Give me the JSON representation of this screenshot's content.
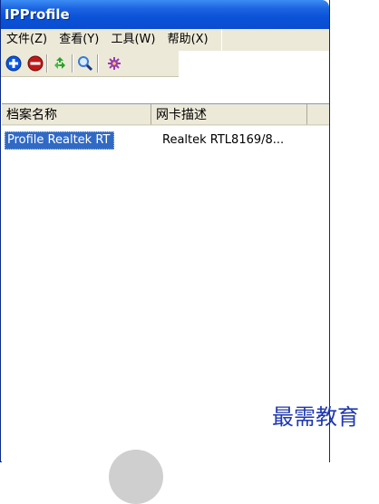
{
  "window": {
    "title": "IPProfile"
  },
  "menu": {
    "items": [
      {
        "label": "文件(Z)"
      },
      {
        "label": "查看(Y)"
      },
      {
        "label": "工具(W)"
      },
      {
        "label": "帮助(X)"
      }
    ]
  },
  "toolbar": {
    "buttons": [
      {
        "icon": "add-icon",
        "color": "#0a56e0"
      },
      {
        "icon": "delete-icon",
        "color": "#c01818"
      },
      {
        "icon": "refresh-icon",
        "color": "#2aa02a"
      },
      {
        "icon": "search-icon",
        "color": "#3a7ad8"
      },
      {
        "icon": "settings-icon",
        "color": "#9a3ab0"
      }
    ]
  },
  "list": {
    "columns": [
      {
        "label": "档案名称"
      },
      {
        "label": "网卡描述"
      }
    ],
    "rows": [
      {
        "name": "Profile Realtek RT",
        "description": "Realtek RTL8169/8..."
      }
    ]
  },
  "watermark": {
    "text": "最需教育"
  },
  "colors": {
    "titlebar": "#0a52d8",
    "selection": "#316ac5",
    "chrome": "#ece9d8"
  }
}
